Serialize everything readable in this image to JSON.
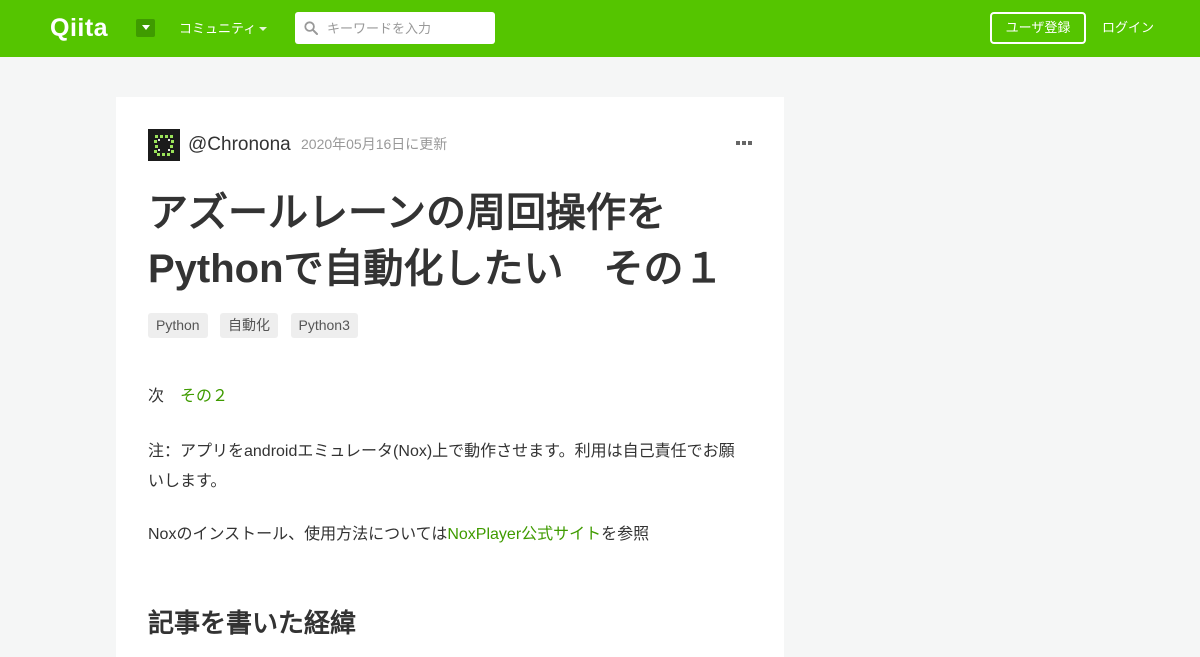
{
  "header": {
    "logo_text": "Qiita",
    "community_label": "コミュニティ",
    "search_placeholder": "キーワードを入力",
    "signup_label": "ユーザ登録",
    "login_label": "ログイン",
    "brand_color": "#55c500"
  },
  "article": {
    "author": "@Chronona",
    "updated": "2020年05月16日に更新",
    "title_line1": "アズールレーンの周回操作を",
    "title_line2": "Pythonで自動化したい　その１",
    "tags": [
      "Python",
      "自動化",
      "Python3"
    ],
    "next_label": "次",
    "next_link": "その２",
    "note_text": "注：アプリをandroidエミュレータ(Nox)上で動作させます。利用は自己責任でお願いします。",
    "nox_prefix": "Noxのインストール、使用方法については",
    "nox_link": "NoxPlayer公式サイト",
    "nox_suffix": "を参照",
    "heading": "記事を書いた経緯"
  },
  "icons": {
    "logo_menu": "caret-down-icon",
    "community": "caret-down-icon",
    "search": "search-icon",
    "more": "more-horizontal-icon",
    "avatar": "pixel-avatar"
  },
  "colors": {
    "link": "#3f9b00",
    "background": "#f5f6f6",
    "tag_bg": "#eeeeee"
  }
}
